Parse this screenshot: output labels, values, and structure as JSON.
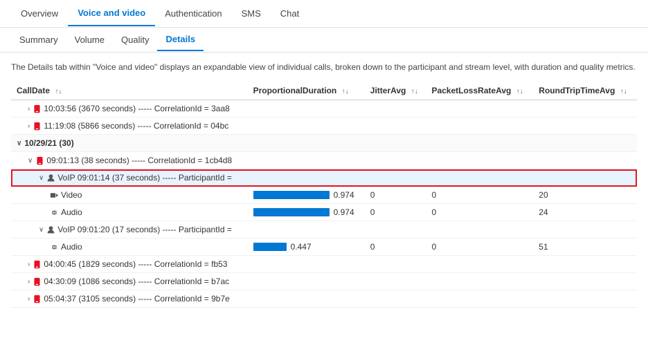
{
  "topNav": {
    "items": [
      {
        "label": "Overview",
        "active": false
      },
      {
        "label": "Voice and video",
        "active": true
      },
      {
        "label": "Authentication",
        "active": false
      },
      {
        "label": "SMS",
        "active": false
      },
      {
        "label": "Chat",
        "active": false
      }
    ]
  },
  "subNav": {
    "items": [
      {
        "label": "Summary",
        "active": false
      },
      {
        "label": "Volume",
        "active": false
      },
      {
        "label": "Quality",
        "active": false
      },
      {
        "label": "Details",
        "active": true
      }
    ]
  },
  "description": "The Details tab within \"Voice and video\" displays an expandable view of individual calls, broken down to the participant and stream level, with duration and quality metrics.",
  "table": {
    "columns": [
      {
        "label": "CallDate",
        "sortable": true
      },
      {
        "label": "ProportionalDuration",
        "sortable": true
      },
      {
        "label": "JitterAvg",
        "sortable": true
      },
      {
        "label": "PacketLossRateAvg",
        "sortable": true
      },
      {
        "label": "RoundTripTimeAvg",
        "sortable": true
      }
    ],
    "rows": [
      {
        "type": "call",
        "indent": 1,
        "expand": true,
        "icon": "phone",
        "label": "10:03:56 (3670 seconds) ----- CorrelationId = 3aa8",
        "bar": null,
        "jitter": null,
        "packetLoss": null,
        "rtt": null
      },
      {
        "type": "call",
        "indent": 1,
        "expand": true,
        "icon": "phone",
        "label": "11:19:08 (5866 seconds) ----- CorrelationId = 04bc",
        "bar": null,
        "jitter": null,
        "packetLoss": null,
        "rtt": null
      },
      {
        "type": "date",
        "indent": 0,
        "expand": true,
        "icon": null,
        "label": "10/29/21 (30)",
        "bar": null,
        "jitter": null,
        "packetLoss": null,
        "rtt": null
      },
      {
        "type": "call-expand",
        "indent": 1,
        "expand": true,
        "icon": "phone",
        "label": "09:01:13 (38 seconds) ----- CorrelationId = 1cb4d8",
        "bar": null,
        "jitter": null,
        "packetLoss": null,
        "rtt": null,
        "highlighted": false
      },
      {
        "type": "voip",
        "indent": 2,
        "expand": true,
        "icon": "user",
        "label": "VoIP 09:01:14 (37 seconds) ----- ParticipantId =",
        "bar": null,
        "jitter": null,
        "packetLoss": null,
        "rtt": null,
        "highlighted": true,
        "outlined": true
      },
      {
        "type": "stream",
        "indent": 3,
        "expand": false,
        "icon": "video",
        "label": "Video",
        "bar": "full",
        "jitter": "0.974",
        "packetLoss": "0",
        "rtt": "0",
        "rttVal": "20"
      },
      {
        "type": "stream",
        "indent": 3,
        "expand": false,
        "icon": "audio",
        "label": "Audio",
        "bar": "full",
        "jitter": "0.974",
        "packetLoss": "0",
        "rtt": "0",
        "rttVal": "24"
      },
      {
        "type": "voip2",
        "indent": 2,
        "expand": true,
        "icon": "user",
        "label": "VoIP 09:01:20 (17 seconds) ----- ParticipantId =",
        "bar": null,
        "jitter": null,
        "packetLoss": null,
        "rtt": null,
        "highlighted": false
      },
      {
        "type": "stream2",
        "indent": 3,
        "expand": false,
        "icon": "audio",
        "label": "Audio",
        "bar": "partial",
        "jitter": "0.447",
        "packetLoss": "0",
        "rtt": "0",
        "rttVal": "51"
      },
      {
        "type": "call2",
        "indent": 1,
        "expand": true,
        "icon": "phone",
        "label": "04:00:45 (1829 seconds) ----- CorrelationId = fb53",
        "bar": null,
        "jitter": null,
        "packetLoss": null,
        "rtt": null
      },
      {
        "type": "call3",
        "indent": 1,
        "expand": true,
        "icon": "phone",
        "label": "04:30:09 (1086 seconds) ----- CorrelationId = b7ac",
        "bar": null,
        "jitter": null,
        "packetLoss": null,
        "rtt": null
      },
      {
        "type": "call4",
        "indent": 1,
        "expand": true,
        "icon": "phone",
        "label": "05:04:37 (3105 seconds) ----- CorrelationId = 9b7e",
        "bar": null,
        "jitter": null,
        "packetLoss": null,
        "rtt": null
      }
    ]
  }
}
